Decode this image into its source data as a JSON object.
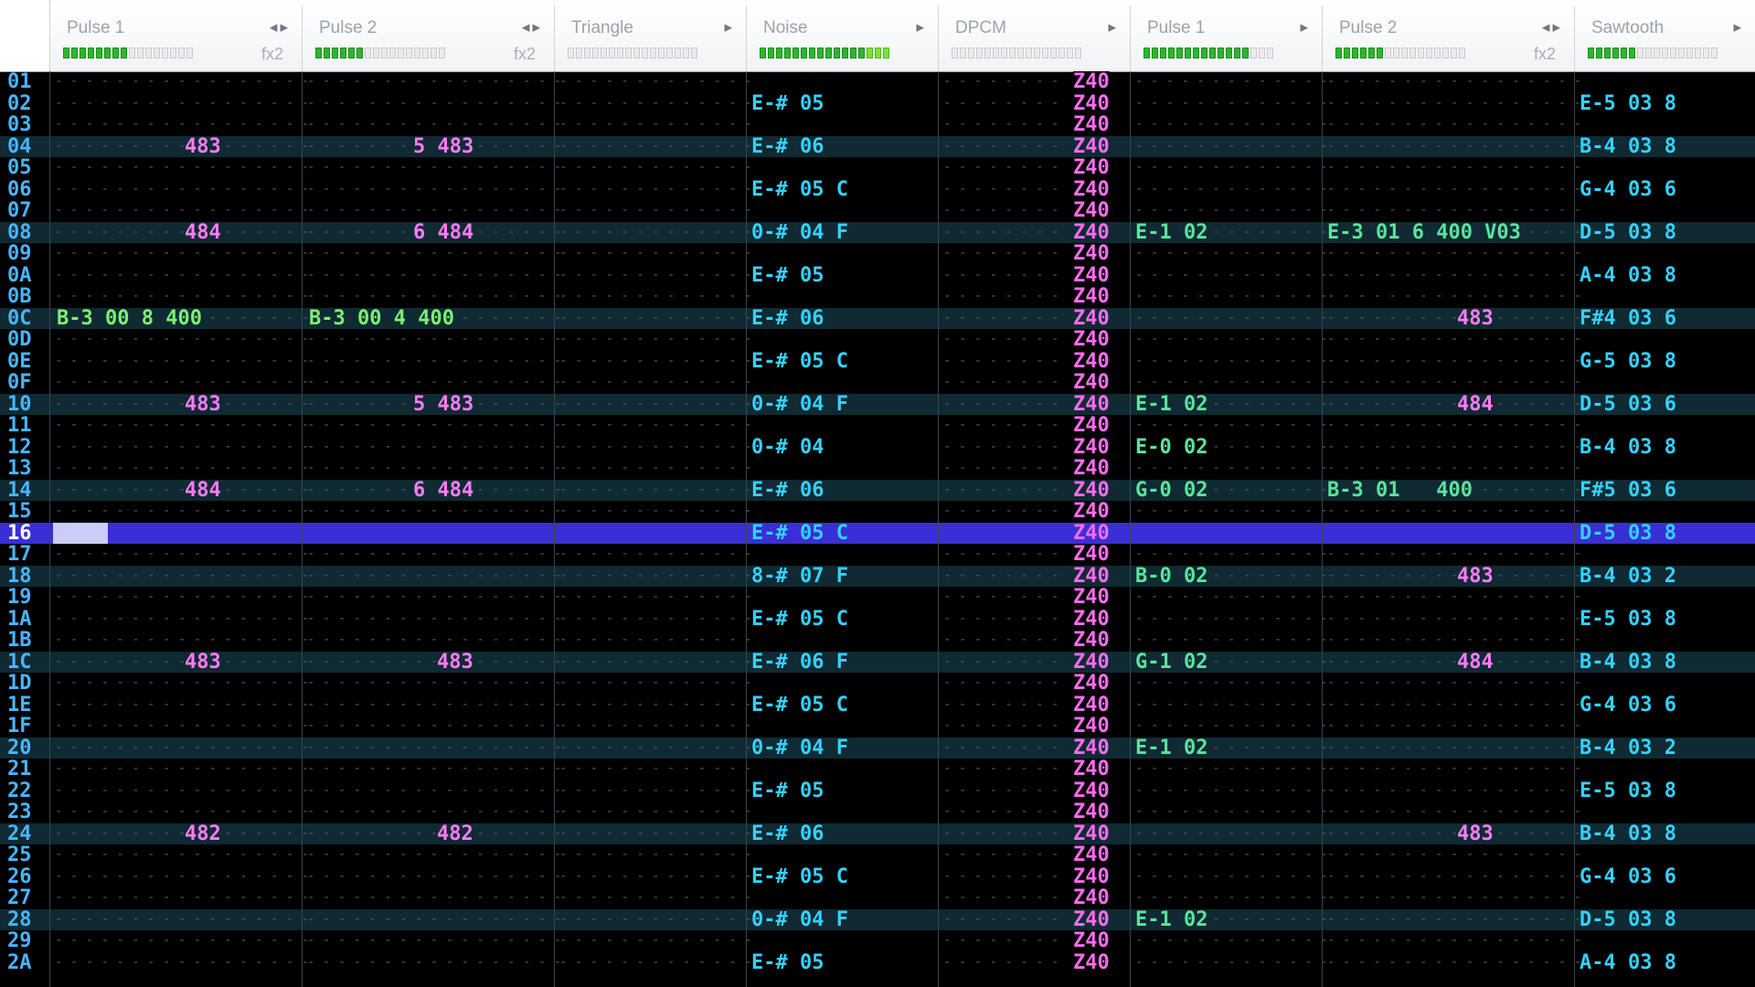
{
  "channels": [
    {
      "name": "Pulse 1",
      "fx": "fx2",
      "arrows": "◂▸",
      "level": 0.5
    },
    {
      "name": "Pulse 2",
      "fx": "fx2",
      "arrows": "◂▸",
      "level": 0.4
    },
    {
      "name": "Triangle",
      "fx": "",
      "arrows": "▸",
      "level": 0.0
    },
    {
      "name": "Noise",
      "fx": "",
      "arrows": "▸",
      "level": 1.0
    },
    {
      "name": "DPCM",
      "fx": "",
      "arrows": "▸",
      "level": 0.0
    },
    {
      "name": "Pulse 1",
      "fx": "",
      "arrows": "▸",
      "level": 0.8
    },
    {
      "name": "Pulse 2",
      "fx": "fx2",
      "arrows": "◂▸",
      "level": 0.4
    },
    {
      "name": "Sawtooth",
      "fx": "",
      "arrows": "▸",
      "level": 0.4
    }
  ],
  "selected_row": "16",
  "rows": [
    {
      "n": "01",
      "beat": false
    },
    {
      "n": "02",
      "beat": false,
      "noise": "E-# 05",
      "saw": "E-5 03 8"
    },
    {
      "n": "03",
      "beat": false
    },
    {
      "n": "04",
      "beat": true,
      "p1": "483",
      "p2": "5 483",
      "noise": "E-# 06",
      "saw": "B-4 03 8"
    },
    {
      "n": "05",
      "beat": false
    },
    {
      "n": "06",
      "beat": false,
      "noise": "E-# 05 C",
      "saw": "G-4 03 6"
    },
    {
      "n": "07",
      "beat": false
    },
    {
      "n": "08",
      "beat": true,
      "p1": "484",
      "p2": "6 484",
      "noise": "0-# 04 F",
      "vp1": "E-1 02",
      "vp2": "E-3 01 6 400 V03",
      "saw": "D-5 03 8"
    },
    {
      "n": "09",
      "beat": false
    },
    {
      "n": "0A",
      "beat": false,
      "noise": "E-# 05",
      "saw": "A-4 03 8"
    },
    {
      "n": "0B",
      "beat": false
    },
    {
      "n": "0C",
      "beat": true,
      "p1": "B-3 00 8 400",
      "p2": "B-3 00 4 400",
      "noise": "E-# 06",
      "vp2r": "483",
      "saw": "F#4 03 6"
    },
    {
      "n": "0D",
      "beat": false
    },
    {
      "n": "0E",
      "beat": false,
      "noise": "E-# 05 C",
      "saw": "G-5 03 8"
    },
    {
      "n": "0F",
      "beat": false
    },
    {
      "n": "10",
      "beat": true,
      "p1": "483",
      "p2": "5 483",
      "noise": "0-# 04 F",
      "vp1": "E-1 02",
      "vp2r": "484",
      "saw": "D-5 03 6"
    },
    {
      "n": "11",
      "beat": false
    },
    {
      "n": "12",
      "beat": false,
      "noise": "0-# 04",
      "vp1": "E-0 02",
      "saw": "B-4 03 8"
    },
    {
      "n": "13",
      "beat": false
    },
    {
      "n": "14",
      "beat": true,
      "p1": "484",
      "p2": "6 484",
      "noise": "E-# 06",
      "vp1": "G-0 02",
      "vp2": "B-3 01   400",
      "saw": "F#5 03 6"
    },
    {
      "n": "15",
      "beat": false
    },
    {
      "n": "16",
      "beat": false,
      "noise": "E-# 05 C",
      "saw": "D-5 03 8"
    },
    {
      "n": "17",
      "beat": false
    },
    {
      "n": "18",
      "beat": true,
      "noise": "8-# 07 F",
      "vp1": "B-0 02",
      "vp2r": "483",
      "saw": "B-4 03 2"
    },
    {
      "n": "19",
      "beat": false
    },
    {
      "n": "1A",
      "beat": false,
      "noise": "E-# 05 C",
      "saw": "E-5 03 8"
    },
    {
      "n": "1B",
      "beat": false
    },
    {
      "n": "1C",
      "beat": true,
      "p1": "483",
      "p2r": "483",
      "noise": "E-# 06 F",
      "vp1": "G-1 02",
      "vp2r": "484",
      "saw": "B-4 03 8"
    },
    {
      "n": "1D",
      "beat": false
    },
    {
      "n": "1E",
      "beat": false,
      "noise": "E-# 05 C",
      "saw": "G-4 03 6"
    },
    {
      "n": "1F",
      "beat": false
    },
    {
      "n": "20",
      "beat": true,
      "noise": "0-# 04 F",
      "vp1": "E-1 02",
      "saw": "B-4 03 2"
    },
    {
      "n": "21",
      "beat": false
    },
    {
      "n": "22",
      "beat": false,
      "noise": "E-# 05",
      "saw": "E-5 03 8"
    },
    {
      "n": "23",
      "beat": false
    },
    {
      "n": "24",
      "beat": true,
      "p1": "482",
      "p2r": "482",
      "noise": "E-# 06",
      "vp2r": "483",
      "saw": "B-4 03 8"
    },
    {
      "n": "25",
      "beat": false
    },
    {
      "n": "26",
      "beat": false,
      "noise": "E-# 05 C",
      "saw": "G-4 03 6"
    },
    {
      "n": "27",
      "beat": false
    },
    {
      "n": "28",
      "beat": true,
      "noise": "0-# 04 F",
      "vp1": "E-1 02",
      "saw": "D-5 03 8"
    },
    {
      "n": "29",
      "beat": false
    },
    {
      "n": "2A",
      "beat": false,
      "noise": "E-# 05",
      "saw": "A-4 03 8"
    }
  ],
  "dpcm_value": "Z40"
}
